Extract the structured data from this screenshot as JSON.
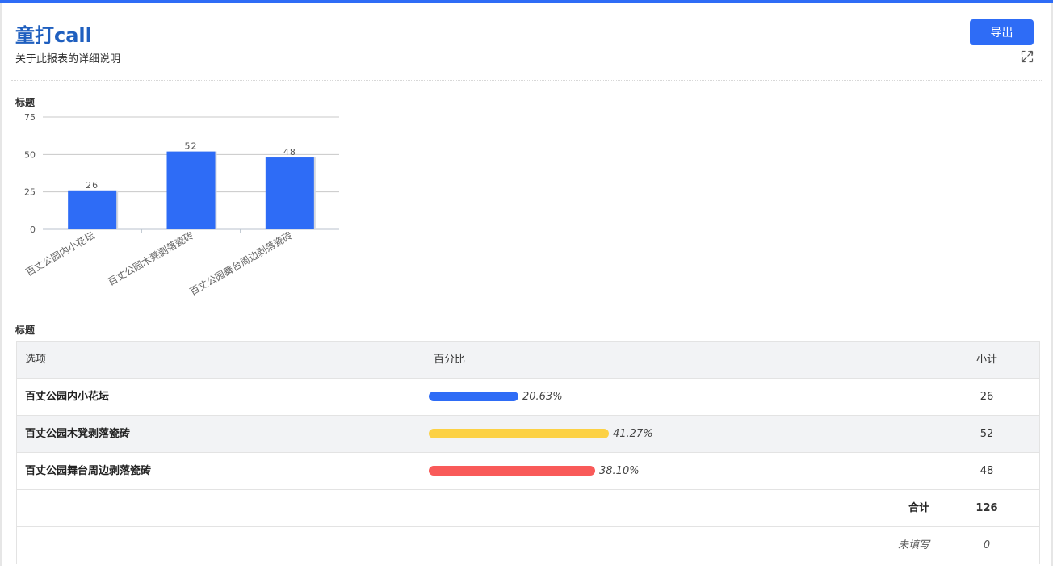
{
  "header": {
    "title": "童打call",
    "subtitle": "关于此报表的详细说明",
    "export_label": "导出"
  },
  "colors": {
    "accent": "#2e6cf6",
    "bar_yellow": "#fcd144",
    "bar_red": "#f95a59"
  },
  "chart_section": {
    "title": "标题"
  },
  "chart_data": {
    "type": "bar",
    "categories": [
      "百丈公园内小花坛",
      "百丈公园木凳剥落瓷砖",
      "百丈公园舞台周边剥落瓷砖"
    ],
    "values": [
      26,
      52,
      48
    ],
    "ylim": [
      0,
      75
    ],
    "yticks": [
      0,
      25,
      50,
      75
    ],
    "grid": true,
    "bar_color": "#2e6cf6"
  },
  "table_section": {
    "title": "标题"
  },
  "table": {
    "headers": {
      "option": "选项",
      "percent": "百分比",
      "subtotal": "小计"
    },
    "rows": [
      {
        "option": "百丈公园内小花坛",
        "percent_text": "20.63%",
        "percent": 20.63,
        "color": "#2e6cf6",
        "subtotal": "26"
      },
      {
        "option": "百丈公园木凳剥落瓷砖",
        "percent_text": "41.27%",
        "percent": 41.27,
        "color": "#fcd144",
        "subtotal": "52"
      },
      {
        "option": "百丈公园舞台周边剥落瓷砖",
        "percent_text": "38.10%",
        "percent": 38.1,
        "color": "#f95a59",
        "subtotal": "48"
      }
    ],
    "total_label": "合计",
    "total_value": "126",
    "unfilled_label": "未填写",
    "unfilled_value": "0"
  }
}
